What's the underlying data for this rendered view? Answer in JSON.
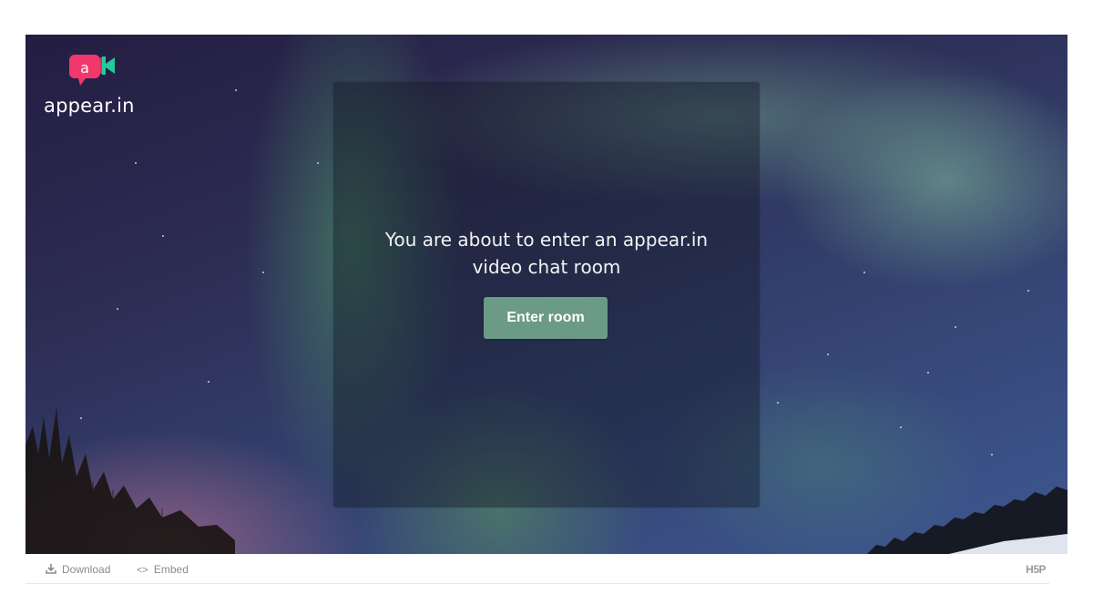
{
  "brand": {
    "logo_letter": "a",
    "name": "appear.in",
    "colors": {
      "bubble": "#f0386b",
      "camera": "#23c99c"
    }
  },
  "dialog": {
    "message_line1": "You are about to enter an appear.in",
    "message_line2": "video chat room",
    "button_label": "Enter room",
    "button_color": "#6b9a86"
  },
  "footer": {
    "download_label": "Download",
    "download_icon": "download-icon",
    "embed_label": "Embed",
    "embed_icon": "code-icon",
    "embed_glyph": "<>",
    "h5p_label": "H5P"
  }
}
